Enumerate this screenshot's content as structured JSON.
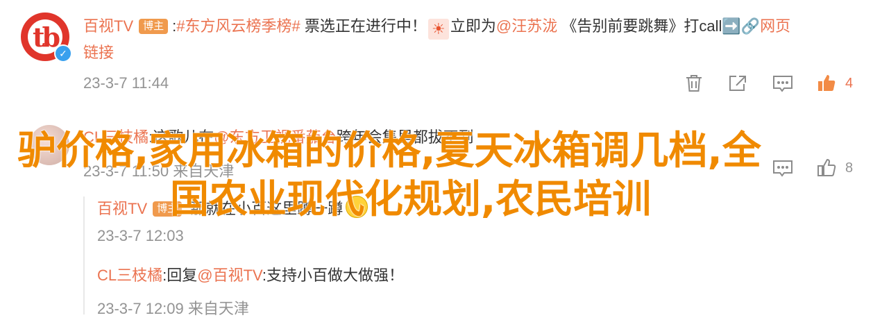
{
  "post": {
    "author": "百视TV",
    "badge": "博主",
    "text_prefix": ":",
    "hashtag": "#东方风云榜季榜#",
    "text1": " 票选正在进行中！",
    "emoji": "☀",
    "text2": "立即为",
    "mention": "@汪苏泷",
    "text3": " 《告别前要跳舞》打call",
    "link_arrow": "➡️",
    "link_icon": "🔗",
    "link_label": "网页",
    "link_label2": "链接",
    "timestamp": "23-3-7 11:44",
    "like_count": "4"
  },
  "comment": {
    "author": "CL三枝橘",
    "separator": ":",
    "text_a": "这歌儿在",
    "mention": "@东方卫视番茄台",
    "text_b": "跨年会集里都拔不到",
    "meta": "23-3-7 11:50 来自天津",
    "like_count": "8"
  },
  "replies": [
    {
      "author": "百视TV",
      "badge": "博主",
      "text": ":那就在小百这里蹲一蹲",
      "meta": "23-3-7 12:03"
    },
    {
      "author": "CL三枝橘",
      "text_a": ":回复",
      "mention": "@百视TV",
      "text_b": ":支持小百做大做强！",
      "meta": "23-3-7 12:09 来自天津"
    }
  ],
  "overlay": {
    "line1": "驴价格,家用冰箱的价格,夏天冰箱调几档,全",
    "line2": "国农业现代化规划,农民培训"
  },
  "avatar": {
    "logo": "tb",
    "verified": "✓"
  },
  "colors": {
    "accent": "#eb7350",
    "meta": "#939393",
    "overlay": "#f08a00",
    "avatar": "#e0352b",
    "verified": "#39a0ee"
  }
}
